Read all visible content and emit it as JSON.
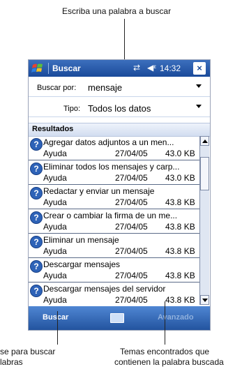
{
  "callouts": {
    "top": "Escriba una palabra a buscar",
    "bottom_left_line1": "se para buscar",
    "bottom_left_line2": "labras",
    "bottom_right_line1": "Temas encontrados que",
    "bottom_right_line2": "contienen la palabra buscada"
  },
  "titlebar": {
    "title": "Buscar",
    "time": "14:32",
    "close_label": "×",
    "icons": [
      "windows-logo-icon",
      "sync-icon",
      "volume-icon",
      "close-icon"
    ]
  },
  "form": {
    "search_label": "Buscar por:",
    "search_value": "mensaje",
    "type_label": "Tipo:",
    "type_value": "Todos los datos"
  },
  "results": {
    "header": "Resultados",
    "items": [
      {
        "title": "Agregar datos adjuntos a un men...",
        "category": "Ayuda",
        "date": "27/04/05",
        "size": "43.0 KB"
      },
      {
        "title": "Eliminar todos los mensajes y carp...",
        "category": "Ayuda",
        "date": "27/04/05",
        "size": "43.0 KB"
      },
      {
        "title": "Redactar y enviar un mensaje",
        "category": "Ayuda",
        "date": "27/04/05",
        "size": "43.8 KB"
      },
      {
        "title": "Crear o cambiar la firma de un me...",
        "category": "Ayuda",
        "date": "27/04/05",
        "size": "43.8 KB"
      },
      {
        "title": "Eliminar un mensaje",
        "category": "Ayuda",
        "date": "27/04/05",
        "size": "43.8 KB"
      },
      {
        "title": "Descargar mensajes",
        "category": "Ayuda",
        "date": "27/04/05",
        "size": "43.8 KB"
      },
      {
        "title": "Descargar mensajes del servidor",
        "category": "Ayuda",
        "date": "27/04/05",
        "size": "43.8 KB"
      }
    ]
  },
  "menubar": {
    "left": "Buscar",
    "right": "Avanzado"
  },
  "colors": {
    "titlebar": "#1a4a9a",
    "menubar": "#23549f",
    "help_icon": "#2e63b8"
  }
}
